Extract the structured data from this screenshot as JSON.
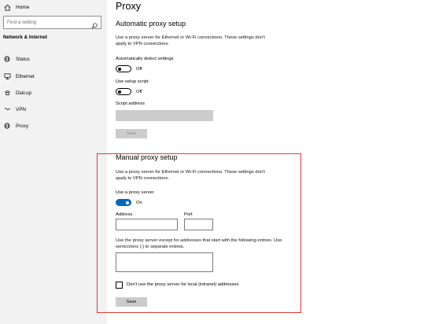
{
  "sidebar": {
    "home_label": "Home",
    "search_placeholder": "Find a setting",
    "section_title": "Network & Internet",
    "items": [
      {
        "label": "Status",
        "icon": "globe-icon"
      },
      {
        "label": "Ethernet",
        "icon": "ethernet-icon"
      },
      {
        "label": "Dial-up",
        "icon": "dialup-icon"
      },
      {
        "label": "VPN",
        "icon": "vpn-icon"
      },
      {
        "label": "Proxy",
        "icon": "globe-icon"
      }
    ]
  },
  "main": {
    "title": "Proxy",
    "auto": {
      "heading": "Automatic proxy setup",
      "description": "Use a proxy server for Ethernet or Wi-Fi connections. These settings don't apply to VPN connections.",
      "detect_label": "Automatically detect settings",
      "detect_state": "Off",
      "script_label": "Use setup script",
      "script_state": "Off",
      "address_label": "Script address",
      "save_label": "Save"
    },
    "manual": {
      "heading": "Manual proxy setup",
      "description": "Use a proxy server for Ethernet or Wi-Fi connections. These settings don't apply to VPN connections.",
      "use_proxy_label": "Use a proxy server",
      "use_proxy_state": "On",
      "address_label": "Address",
      "port_label": "Port",
      "exceptions_label": "Use the proxy server except for addresses that start with the following entries. Use semicolons (;) to separate entries.",
      "local_checkbox_label": "Don't use the proxy server for local (intranet) addresses",
      "save_label": "Save"
    }
  },
  "colors": {
    "sidebar_bg": "#f2f2f2",
    "accent": "#0067c0",
    "highlight": "#e53935"
  }
}
